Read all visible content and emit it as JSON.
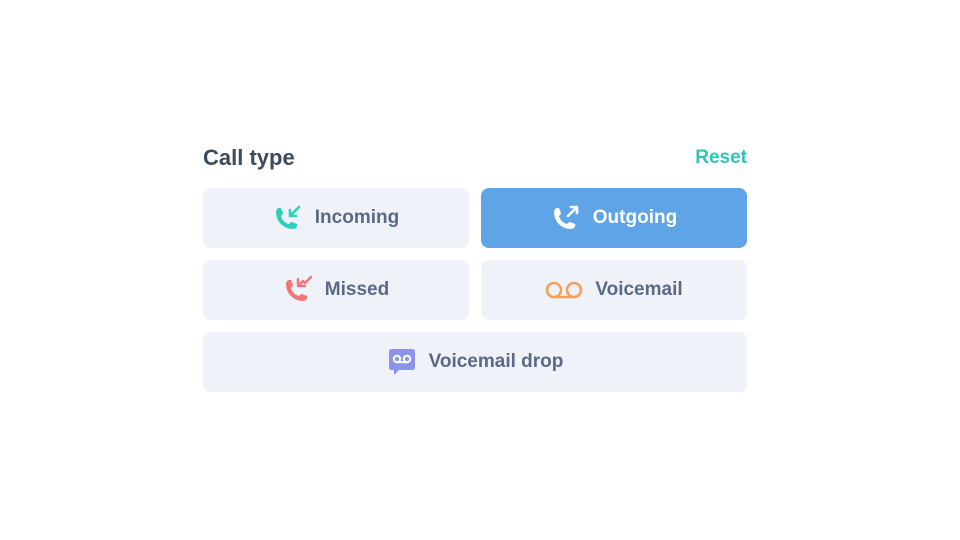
{
  "filter": {
    "title": "Call type",
    "reset_label": "Reset",
    "options": [
      {
        "label": "Incoming",
        "icon": "incoming-call-icon",
        "color": "#2ecfb8",
        "selected": false
      },
      {
        "label": "Outgoing",
        "icon": "outgoing-call-icon",
        "color": "#ffffff",
        "selected": true
      },
      {
        "label": "Missed",
        "icon": "missed-call-icon",
        "color": "#f07777",
        "selected": false
      },
      {
        "label": "Voicemail",
        "icon": "voicemail-icon",
        "color": "#f5a05a",
        "selected": false
      },
      {
        "label": "Voicemail drop",
        "icon": "voicemail-drop-icon",
        "color": "#8c94e8",
        "selected": false
      }
    ]
  },
  "colors": {
    "accent": "#2ec4b6",
    "selected_bg": "#5fa4e6",
    "option_bg": "#eff2f9",
    "text": "#5a6a86",
    "title": "#3d4a5e"
  }
}
